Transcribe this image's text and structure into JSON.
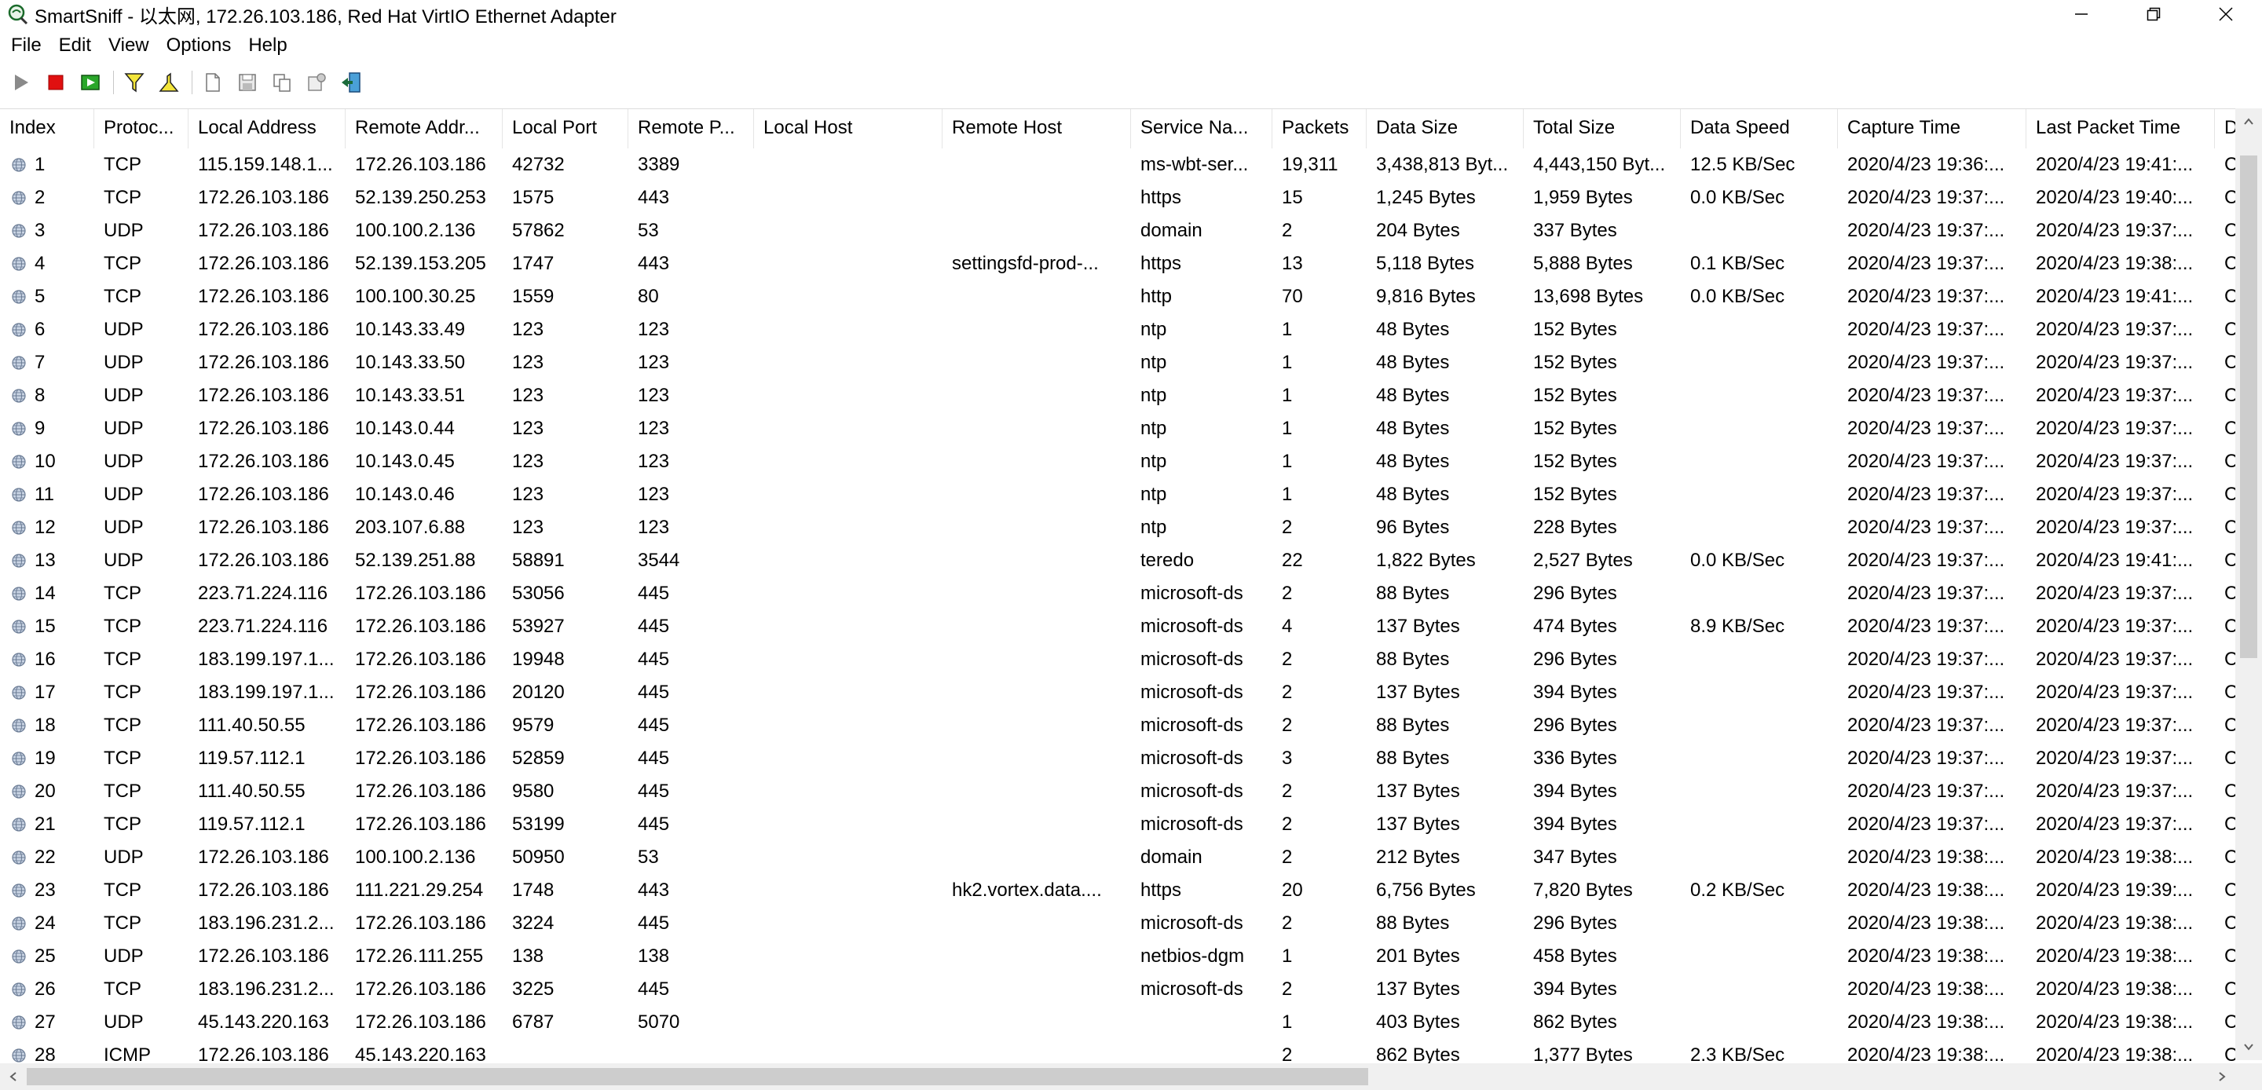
{
  "window": {
    "title": "SmartSniff  -  以太网, 172.26.103.186, Red Hat VirtIO Ethernet Adapter"
  },
  "menu": [
    "File",
    "Edit",
    "View",
    "Options",
    "Help"
  ],
  "toolbar_icons": [
    "start-capture",
    "stop-capture",
    "start-capture-from-file",
    "filter",
    "display-filter",
    "new",
    "save",
    "copy",
    "properties",
    "exit"
  ],
  "columns": [
    "Index",
    "Protoc...",
    "Local Address",
    "Remote Addr...",
    "Local Port",
    "Remote P...",
    "Local Host",
    "Remote Host",
    "Service Na...",
    "Packets",
    "Data Size",
    "Total Size",
    "Data Speed",
    "Capture Time",
    "Last Packet Time",
    "D"
  ],
  "rows": [
    [
      "1",
      "TCP",
      "115.159.148.1...",
      "172.26.103.186",
      "42732",
      "3389",
      "",
      "",
      "ms-wbt-ser...",
      "19,311",
      "3,438,813 Byt...",
      "4,443,150 Byt...",
      "12.5 KB/Sec",
      "2020/4/23 19:36:...",
      "2020/4/23 19:41:...",
      "C"
    ],
    [
      "2",
      "TCP",
      "172.26.103.186",
      "52.139.250.253",
      "1575",
      "443",
      "",
      "",
      "https",
      "15",
      "1,245 Bytes",
      "1,959 Bytes",
      "0.0 KB/Sec",
      "2020/4/23 19:37:...",
      "2020/4/23 19:40:...",
      "C"
    ],
    [
      "3",
      "UDP",
      "172.26.103.186",
      "100.100.2.136",
      "57862",
      "53",
      "",
      "",
      "domain",
      "2",
      "204 Bytes",
      "337 Bytes",
      "",
      "2020/4/23 19:37:...",
      "2020/4/23 19:37:...",
      "C"
    ],
    [
      "4",
      "TCP",
      "172.26.103.186",
      "52.139.153.205",
      "1747",
      "443",
      "",
      "settingsfd-prod-...",
      "https",
      "13",
      "5,118 Bytes",
      "5,888 Bytes",
      "0.1 KB/Sec",
      "2020/4/23 19:37:...",
      "2020/4/23 19:38:...",
      "C"
    ],
    [
      "5",
      "TCP",
      "172.26.103.186",
      "100.100.30.25",
      "1559",
      "80",
      "",
      "",
      "http",
      "70",
      "9,816 Bytes",
      "13,698 Bytes",
      "0.0 KB/Sec",
      "2020/4/23 19:37:...",
      "2020/4/23 19:41:...",
      "C"
    ],
    [
      "6",
      "UDP",
      "172.26.103.186",
      "10.143.33.49",
      "123",
      "123",
      "",
      "",
      "ntp",
      "1",
      "48 Bytes",
      "152 Bytes",
      "",
      "2020/4/23 19:37:...",
      "2020/4/23 19:37:...",
      "C"
    ],
    [
      "7",
      "UDP",
      "172.26.103.186",
      "10.143.33.50",
      "123",
      "123",
      "",
      "",
      "ntp",
      "1",
      "48 Bytes",
      "152 Bytes",
      "",
      "2020/4/23 19:37:...",
      "2020/4/23 19:37:...",
      "C"
    ],
    [
      "8",
      "UDP",
      "172.26.103.186",
      "10.143.33.51",
      "123",
      "123",
      "",
      "",
      "ntp",
      "1",
      "48 Bytes",
      "152 Bytes",
      "",
      "2020/4/23 19:37:...",
      "2020/4/23 19:37:...",
      "C"
    ],
    [
      "9",
      "UDP",
      "172.26.103.186",
      "10.143.0.44",
      "123",
      "123",
      "",
      "",
      "ntp",
      "1",
      "48 Bytes",
      "152 Bytes",
      "",
      "2020/4/23 19:37:...",
      "2020/4/23 19:37:...",
      "C"
    ],
    [
      "10",
      "UDP",
      "172.26.103.186",
      "10.143.0.45",
      "123",
      "123",
      "",
      "",
      "ntp",
      "1",
      "48 Bytes",
      "152 Bytes",
      "",
      "2020/4/23 19:37:...",
      "2020/4/23 19:37:...",
      "C"
    ],
    [
      "11",
      "UDP",
      "172.26.103.186",
      "10.143.0.46",
      "123",
      "123",
      "",
      "",
      "ntp",
      "1",
      "48 Bytes",
      "152 Bytes",
      "",
      "2020/4/23 19:37:...",
      "2020/4/23 19:37:...",
      "C"
    ],
    [
      "12",
      "UDP",
      "172.26.103.186",
      "203.107.6.88",
      "123",
      "123",
      "",
      "",
      "ntp",
      "2",
      "96 Bytes",
      "228 Bytes",
      "",
      "2020/4/23 19:37:...",
      "2020/4/23 19:37:...",
      "C"
    ],
    [
      "13",
      "UDP",
      "172.26.103.186",
      "52.139.251.88",
      "58891",
      "3544",
      "",
      "",
      "teredo",
      "22",
      "1,822 Bytes",
      "2,527 Bytes",
      "0.0 KB/Sec",
      "2020/4/23 19:37:...",
      "2020/4/23 19:41:...",
      "C"
    ],
    [
      "14",
      "TCP",
      "223.71.224.116",
      "172.26.103.186",
      "53056",
      "445",
      "",
      "",
      "microsoft-ds",
      "2",
      "88 Bytes",
      "296 Bytes",
      "",
      "2020/4/23 19:37:...",
      "2020/4/23 19:37:...",
      "C"
    ],
    [
      "15",
      "TCP",
      "223.71.224.116",
      "172.26.103.186",
      "53927",
      "445",
      "",
      "",
      "microsoft-ds",
      "4",
      "137 Bytes",
      "474 Bytes",
      "8.9 KB/Sec",
      "2020/4/23 19:37:...",
      "2020/4/23 19:37:...",
      "C"
    ],
    [
      "16",
      "TCP",
      "183.199.197.1...",
      "172.26.103.186",
      "19948",
      "445",
      "",
      "",
      "microsoft-ds",
      "2",
      "88 Bytes",
      "296 Bytes",
      "",
      "2020/4/23 19:37:...",
      "2020/4/23 19:37:...",
      "C"
    ],
    [
      "17",
      "TCP",
      "183.199.197.1...",
      "172.26.103.186",
      "20120",
      "445",
      "",
      "",
      "microsoft-ds",
      "2",
      "137 Bytes",
      "394 Bytes",
      "",
      "2020/4/23 19:37:...",
      "2020/4/23 19:37:...",
      "C"
    ],
    [
      "18",
      "TCP",
      "111.40.50.55",
      "172.26.103.186",
      "9579",
      "445",
      "",
      "",
      "microsoft-ds",
      "2",
      "88 Bytes",
      "296 Bytes",
      "",
      "2020/4/23 19:37:...",
      "2020/4/23 19:37:...",
      "C"
    ],
    [
      "19",
      "TCP",
      "119.57.112.1",
      "172.26.103.186",
      "52859",
      "445",
      "",
      "",
      "microsoft-ds",
      "3",
      "88 Bytes",
      "336 Bytes",
      "",
      "2020/4/23 19:37:...",
      "2020/4/23 19:37:...",
      "C"
    ],
    [
      "20",
      "TCP",
      "111.40.50.55",
      "172.26.103.186",
      "9580",
      "445",
      "",
      "",
      "microsoft-ds",
      "2",
      "137 Bytes",
      "394 Bytes",
      "",
      "2020/4/23 19:37:...",
      "2020/4/23 19:37:...",
      "C"
    ],
    [
      "21",
      "TCP",
      "119.57.112.1",
      "172.26.103.186",
      "53199",
      "445",
      "",
      "",
      "microsoft-ds",
      "2",
      "137 Bytes",
      "394 Bytes",
      "",
      "2020/4/23 19:37:...",
      "2020/4/23 19:37:...",
      "C"
    ],
    [
      "22",
      "UDP",
      "172.26.103.186",
      "100.100.2.136",
      "50950",
      "53",
      "",
      "",
      "domain",
      "2",
      "212 Bytes",
      "347 Bytes",
      "",
      "2020/4/23 19:38:...",
      "2020/4/23 19:38:...",
      "C"
    ],
    [
      "23",
      "TCP",
      "172.26.103.186",
      "111.221.29.254",
      "1748",
      "443",
      "",
      "hk2.vortex.data....",
      "https",
      "20",
      "6,756 Bytes",
      "7,820 Bytes",
      "0.2 KB/Sec",
      "2020/4/23 19:38:...",
      "2020/4/23 19:39:...",
      "C"
    ],
    [
      "24",
      "TCP",
      "183.196.231.2...",
      "172.26.103.186",
      "3224",
      "445",
      "",
      "",
      "microsoft-ds",
      "2",
      "88 Bytes",
      "296 Bytes",
      "",
      "2020/4/23 19:38:...",
      "2020/4/23 19:38:...",
      "C"
    ],
    [
      "25",
      "UDP",
      "172.26.103.186",
      "172.26.111.255",
      "138",
      "138",
      "",
      "",
      "netbios-dgm",
      "1",
      "201 Bytes",
      "458 Bytes",
      "",
      "2020/4/23 19:38:...",
      "2020/4/23 19:38:...",
      "C"
    ],
    [
      "26",
      "TCP",
      "183.196.231.2...",
      "172.26.103.186",
      "3225",
      "445",
      "",
      "",
      "microsoft-ds",
      "2",
      "137 Bytes",
      "394 Bytes",
      "",
      "2020/4/23 19:38:...",
      "2020/4/23 19:38:...",
      "C"
    ],
    [
      "27",
      "UDP",
      "45.143.220.163",
      "172.26.103.186",
      "6787",
      "5070",
      "",
      "",
      "",
      "1",
      "403 Bytes",
      "862 Bytes",
      "",
      "2020/4/23 19:38:...",
      "2020/4/23 19:38:...",
      "C"
    ],
    [
      "28",
      "ICMP",
      "172.26.103.186",
      "45.143.220.163",
      "",
      "",
      "",
      "",
      "",
      "2",
      "862 Bytes",
      "1,377 Bytes",
      "2.3 KB/Sec",
      "2020/4/23 19:38:...",
      "2020/4/23 19:38:...",
      "C"
    ]
  ]
}
